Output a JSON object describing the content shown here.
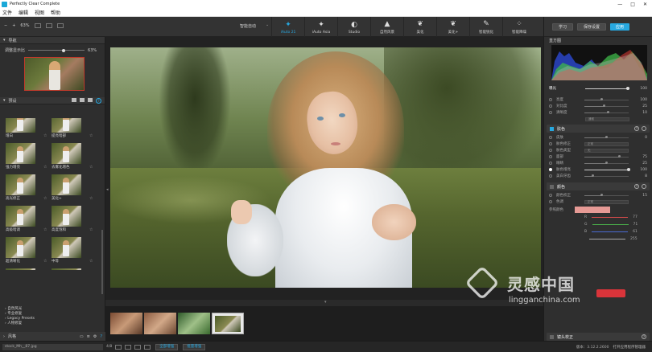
{
  "window": {
    "title": "Perfectly Clear Complete",
    "controls": [
      "—",
      "□",
      "✕"
    ]
  },
  "menu": [
    "文件",
    "编辑",
    "视图",
    "帮助"
  ],
  "toolbar": {
    "zoom_out": "−",
    "zoom_in": "+",
    "zoom_level": "63%",
    "preset_dropdown": "智能自动",
    "presets": [
      {
        "label": "iAuto 21",
        "icon": "magic-wand-icon",
        "active": true
      },
      {
        "label": "iAuto Asia",
        "icon": "magic-wand-icon",
        "active": false
      },
      {
        "label": "Studio",
        "icon": "portrait-icon",
        "active": false
      },
      {
        "label": "自然风景",
        "icon": "landscape-icon",
        "active": false
      },
      {
        "label": "美化",
        "icon": "leaf-icon",
        "active": false
      },
      {
        "label": "美化+",
        "icon": "leaf-plus-icon",
        "active": false
      },
      {
        "label": "智能锐化",
        "icon": "brush-icon",
        "active": false
      },
      {
        "label": "智能降噪",
        "icon": "dice-icon",
        "active": false
      }
    ]
  },
  "left": {
    "navigator": {
      "title": "导航",
      "zoom_label": "调整显示比",
      "zoom_value": "63%",
      "zoom_level": 0.63
    },
    "presets_header": {
      "title": "预设",
      "help": "?"
    },
    "grid": [
      {
        "name": "去雾化"
      },
      {
        "name": "高亮调暗"
      },
      {
        "name": "增白"
      },
      {
        "name": "提亮暗部"
      },
      {
        "name": "强力增亮"
      },
      {
        "name": "去雾化增色"
      },
      {
        "name": "高光修正"
      },
      {
        "name": "美化+"
      },
      {
        "name": "高级暗调"
      },
      {
        "name": "高度饱和"
      },
      {
        "name": "超清晰化"
      },
      {
        "name": "中等"
      },
      {
        "name": "超级去雾"
      },
      {
        "name": "超级去"
      }
    ],
    "tree": [
      "自然风光",
      "专业修复",
      "Legacy Presets",
      "人物修复"
    ],
    "bottom": {
      "title": "风格"
    }
  },
  "right": {
    "buttons": {
      "learn": "学习",
      "save_preset": "保存设置",
      "apply": "应用"
    },
    "histogram_title": "直方图",
    "exposure": {
      "label": "曝光",
      "value": "100",
      "level": 1.0
    },
    "basic_rows": [
      {
        "label": "亮度",
        "value": "100",
        "level": 0.4
      },
      {
        "label": "对比度",
        "value": "25",
        "level": 0.45
      },
      {
        "label": "清晰度",
        "value": "10",
        "level": 0.55
      }
    ],
    "basic_dropdown": "通常",
    "sections": {
      "beautify": {
        "title": "肤色",
        "help": "?"
      },
      "color": {
        "title": "颜色",
        "help": "?"
      },
      "other": {
        "title": "镜头校正",
        "help": "?"
      }
    },
    "beautify_rows": [
      {
        "label": "皮肤",
        "value": "0",
        "level": 0.5,
        "type": "slider",
        "on": false
      },
      {
        "label": "肤色修正",
        "value": "正常",
        "level": 0.0,
        "type": "dropdown",
        "on": false
      },
      {
        "label": "肤色类型",
        "value": "无",
        "level": 0.0,
        "type": "dropdown",
        "on": false
      },
      {
        "label": "面部",
        "value": "75",
        "level": 0.8,
        "type": "slider",
        "on": false
      },
      {
        "label": "眼睛",
        "value": "25",
        "level": 0.5,
        "type": "slider",
        "on": false
      },
      {
        "label": "肤色增亮",
        "value": "100",
        "level": 1.0,
        "type": "slider",
        "on": true
      },
      {
        "label": "美白牙齿",
        "value": "8",
        "level": 0.2,
        "type": "slider",
        "on": false
      }
    ],
    "color_rows": [
      {
        "label": "颜色校正",
        "value": "15",
        "level": 0.4,
        "type": "slider"
      },
      {
        "label": "色调",
        "value": "正常",
        "level": 0.0,
        "type": "dropdown"
      }
    ],
    "color_swatch_label": "参照颜色",
    "channels": [
      {
        "name": "R",
        "value": "77"
      },
      {
        "name": "G",
        "value": "71"
      },
      {
        "name": "B",
        "value": "61"
      },
      {
        "name": "",
        "value": "255"
      }
    ]
  },
  "status": {
    "filename": "stock_Mh__87.jpg",
    "count": "4/8",
    "apply_all": "全部增强",
    "batch": "批量增强",
    "version": "版本：3.12.2.2600",
    "link": "打开应用程序管理器"
  },
  "watermark": {
    "cn": "灵感中国",
    "en": "lingganchina.com"
  },
  "colors": {
    "accent": "#27a8e0",
    "panel": "#2f2f2f",
    "selection": "#c03a2b"
  }
}
